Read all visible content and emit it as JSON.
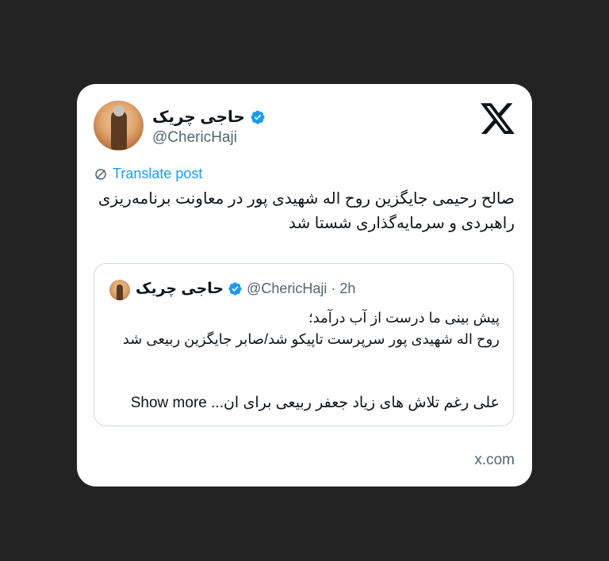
{
  "post": {
    "author_name": "حاجی چریک",
    "author_handle": "@ChericHaji",
    "translate_label": "Translate post",
    "text": "صالح رحیمی جایگزین روح اله شهیدی پور در معاونت برنامه‌ریزی راهبردی و سرمایه‌گذاری شستا شد"
  },
  "quoted": {
    "author_name": "حاجی چریک",
    "author_handle": "@ChericHaji",
    "separator": "·",
    "time": "2h",
    "line1": "پیش بینی ما درست از آب درآمد؛",
    "line2": "روح اله شهیدی پور سرپرست تاپیکو شد/صابر جایگزین ربیعی شد",
    "last_line": "علی رغم تلاش های زیاد جعفر ربیعی برای ان...",
    "show_more": "Show more"
  },
  "source": "x.com",
  "icons": {
    "logo": "x-logo-icon",
    "verified": "verified-badge-icon",
    "translate": "globe-icon"
  },
  "colors": {
    "background": "#232323",
    "card": "#ffffff",
    "accent": "#1d9bf0",
    "muted": "#536471",
    "text": "#0f1419"
  }
}
